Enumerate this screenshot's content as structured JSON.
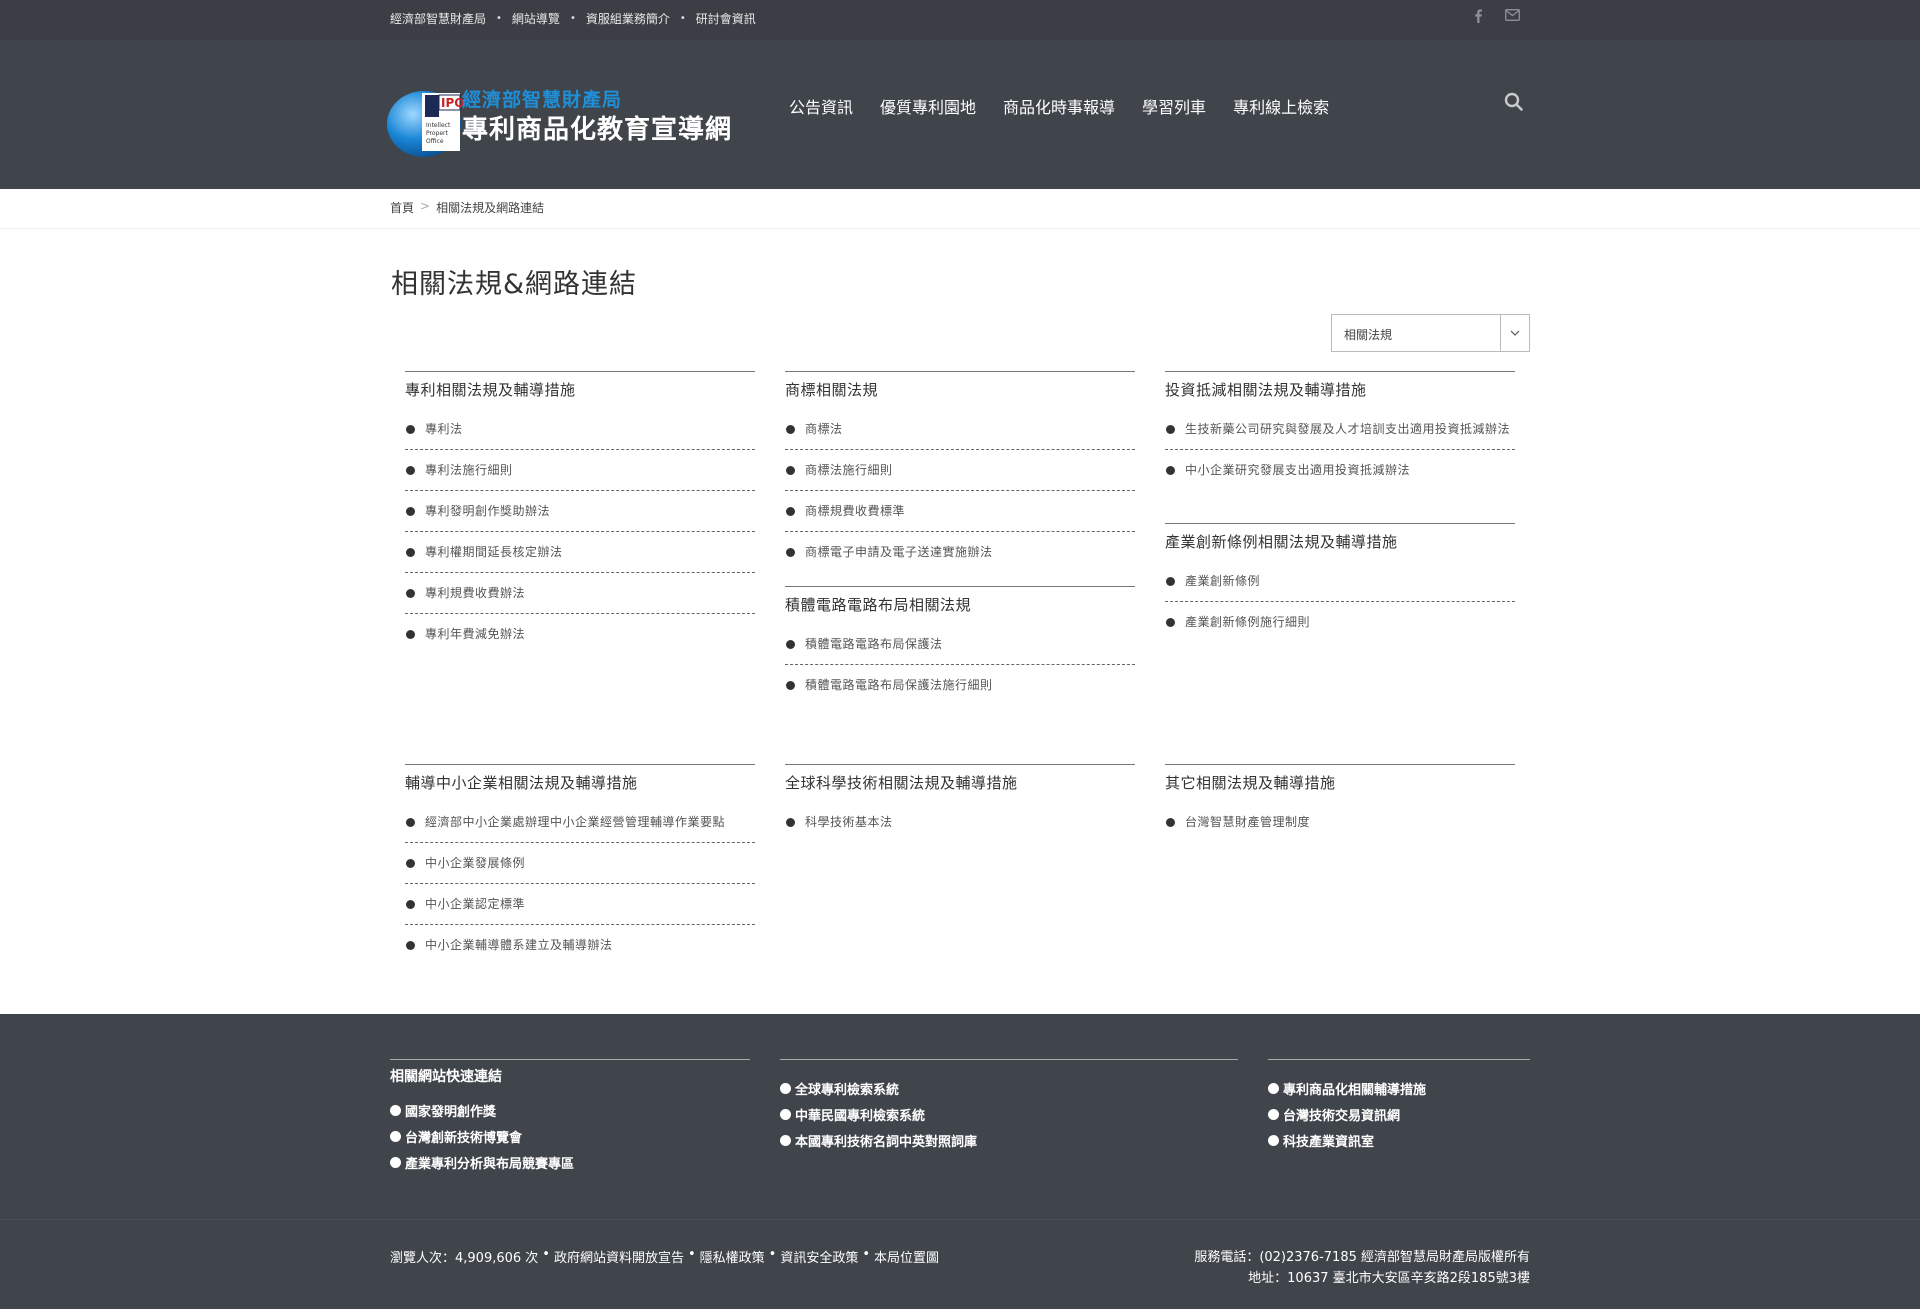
{
  "topbar": {
    "links": [
      "經濟部智慧財產局",
      "網站導覽",
      "資服組業務簡介",
      "研討會資訊"
    ],
    "social_icons": [
      "facebook-icon",
      "mail-icon"
    ]
  },
  "header": {
    "logo_line1": "經濟部智慧財產局",
    "logo_line2": "專利商品化教育宣導網",
    "logo_badge": "IPO",
    "nav": [
      "公告資訊",
      "優質專利園地",
      "商品化時事報導",
      "學習列車",
      "專利線上檢索"
    ]
  },
  "breadcrumb": {
    "home": "首頁",
    "separator": ">",
    "current": "相關法規及網路連結"
  },
  "page_title": "相關法規&網路連結",
  "filter_select": {
    "value": "相關法規"
  },
  "sections": {
    "patent": {
      "title": "專利相關法規及輔導措施",
      "items": [
        "專利法",
        "專利法施行細則",
        "專利發明創作獎助辦法",
        "專利權期間延長核定辦法",
        "專利規費收費辦法",
        "專利年費減免辦法"
      ]
    },
    "trademark": {
      "title": "商標相關法規",
      "items": [
        "商標法",
        "商標法施行細則",
        "商標規費收費標準",
        "商標電子申請及電子送達實施辦法"
      ]
    },
    "ic_layout": {
      "title": "積體電路電路布局相關法規",
      "items": [
        "積體電路電路布局保護法",
        "積體電路電路布局保護法施行細則"
      ]
    },
    "investment": {
      "title": "投資抵減相關法規及輔導措施",
      "items": [
        "生技新藥公司研究與發展及人才培訓支出適用投資抵減辦法",
        "中小企業研究發展支出適用投資抵減辦法"
      ]
    },
    "industry": {
      "title": "產業創新條例相關法規及輔導措施",
      "items": [
        "產業創新條例",
        "產業創新條例施行細則"
      ]
    },
    "sme": {
      "title": "輔導中小企業相關法規及輔導措施",
      "items": [
        "經濟部中小企業處辦理中小企業經營管理輔導作業要點",
        "中小企業發展條例",
        "中小企業認定標準",
        "中小企業輔導體系建立及輔導辦法"
      ]
    },
    "science": {
      "title": "全球科學技術相關法規及輔導措施",
      "items": [
        "科學技術基本法"
      ]
    },
    "other": {
      "title": "其它相關法規及輔導措施",
      "items": [
        "台灣智慧財產管理制度"
      ]
    }
  },
  "footer": {
    "quick_links_title": "相關網站快速連結",
    "col1": [
      "國家發明創作獎",
      "台灣創新技術博覽會",
      "產業專利分析與布局競賽專區"
    ],
    "col2": [
      "全球專利檢索系統",
      "中華民國專利檢索系統",
      "本國專利技術名詞中英對照詞庫"
    ],
    "col3": [
      "專利商品化相關輔導措施",
      "台灣技術交易資訊網",
      "科技產業資訊室"
    ],
    "visitors": "瀏覽人次：4,909,606 次",
    "bottom_links": [
      "政府網站資料開放宣告",
      "隱私權政策",
      "資訊安全政策",
      "本局位置圖"
    ],
    "service_line": "服務電話：(02)2376-7185 經濟部智慧局財產局版權所有",
    "address_line": "地址：10637 臺北市大安區辛亥路2段185號3樓"
  }
}
